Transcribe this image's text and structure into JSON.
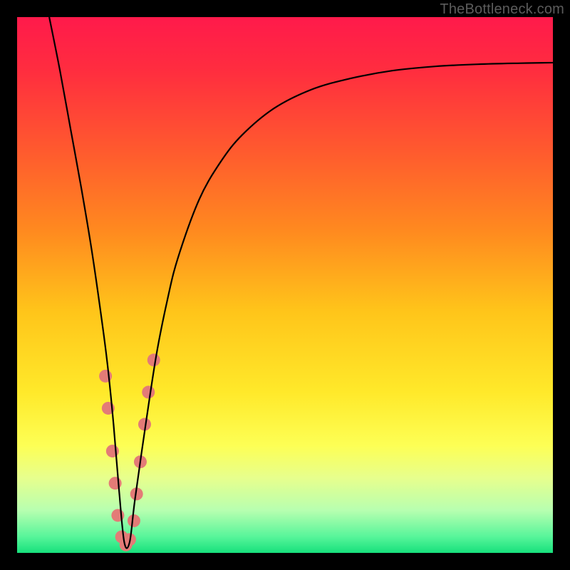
{
  "watermark": "TheBottleneck.com",
  "chart_data": {
    "type": "line",
    "title": "",
    "xlabel": "",
    "ylabel": "",
    "xlim": [
      0,
      100
    ],
    "ylim": [
      0,
      100
    ],
    "grid": false,
    "legend": false,
    "background_gradient_stops": [
      {
        "pos": 0.0,
        "color": "#ff1a4b"
      },
      {
        "pos": 0.1,
        "color": "#ff2d3f"
      },
      {
        "pos": 0.25,
        "color": "#ff5a2e"
      },
      {
        "pos": 0.4,
        "color": "#ff8a1f"
      },
      {
        "pos": 0.55,
        "color": "#ffc51a"
      },
      {
        "pos": 0.7,
        "color": "#ffe92a"
      },
      {
        "pos": 0.8,
        "color": "#fdff55"
      },
      {
        "pos": 0.86,
        "color": "#e7ff8d"
      },
      {
        "pos": 0.92,
        "color": "#b8ffb0"
      },
      {
        "pos": 0.97,
        "color": "#57f59a"
      },
      {
        "pos": 1.0,
        "color": "#17e07c"
      }
    ],
    "series": [
      {
        "name": "bottleneck-curve",
        "color": "#000000",
        "stroke_width": 2.2,
        "x": [
          6,
          8,
          10,
          12,
          14,
          16,
          17,
          18,
          19,
          20,
          21,
          22,
          24,
          26,
          28,
          30,
          34,
          38,
          42,
          48,
          55,
          62,
          70,
          78,
          86,
          94,
          100
        ],
        "y": [
          100,
          90,
          79,
          68,
          56,
          42,
          34,
          24,
          12,
          2,
          2,
          10,
          24,
          37,
          47,
          55,
          66,
          73,
          78,
          83,
          86.5,
          88.5,
          90,
          90.8,
          91.2,
          91.4,
          91.5
        ]
      }
    ],
    "markers": {
      "name": "highlight-points",
      "color": "#e37b77",
      "radius": 9,
      "points": [
        {
          "x": 16.5,
          "y": 33
        },
        {
          "x": 17.0,
          "y": 27
        },
        {
          "x": 17.8,
          "y": 19
        },
        {
          "x": 18.3,
          "y": 13
        },
        {
          "x": 18.8,
          "y": 7
        },
        {
          "x": 19.5,
          "y": 3
        },
        {
          "x": 20.3,
          "y": 1.5
        },
        {
          "x": 21.0,
          "y": 2.5
        },
        {
          "x": 21.8,
          "y": 6
        },
        {
          "x": 22.3,
          "y": 11
        },
        {
          "x": 23.0,
          "y": 17
        },
        {
          "x": 23.8,
          "y": 24
        },
        {
          "x": 24.5,
          "y": 30
        },
        {
          "x": 25.5,
          "y": 36
        }
      ]
    }
  }
}
